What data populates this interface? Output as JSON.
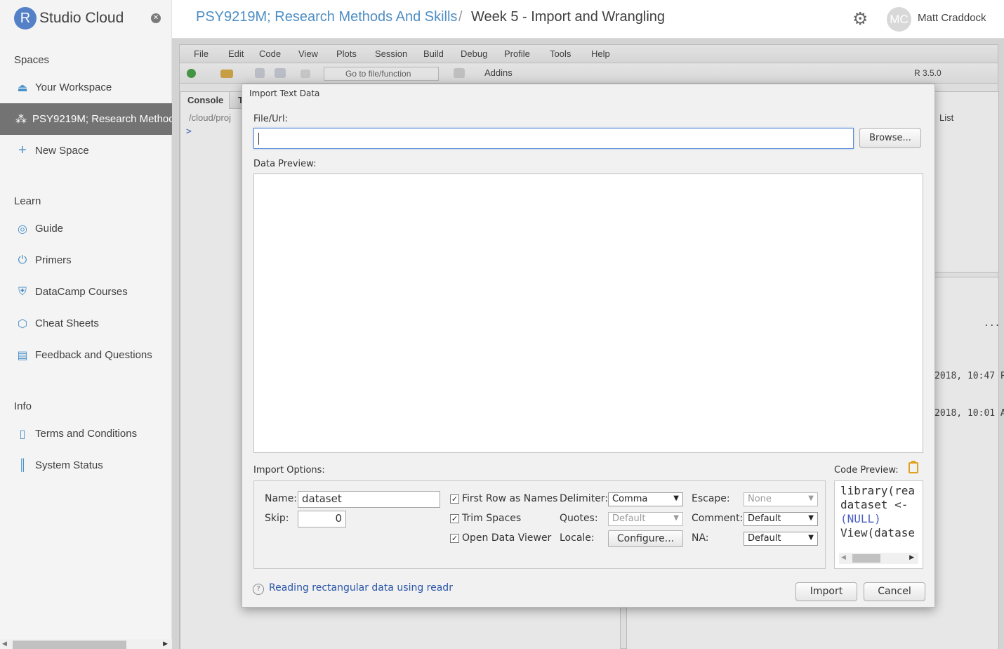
{
  "app": {
    "logo_letter": "R",
    "logo_text": "Studio Cloud"
  },
  "header": {
    "space_name": "PSY9219M; Research Methods And Skills",
    "separator": "/",
    "project_name": "Week 5 - Import and Wrangling",
    "avatar_initials": "MC",
    "user_name": "Matt Craddock"
  },
  "sidebar": {
    "spaces_heading": "Spaces",
    "your_workspace": "Your Workspace",
    "active_space": "PSY9219M; Research Methods And Skills",
    "new_space": "New Space",
    "learn_heading": "Learn",
    "guide": "Guide",
    "primers": "Primers",
    "datacamp": "DataCamp Courses",
    "cheat_sheets": "Cheat Sheets",
    "feedback": "Feedback and Questions",
    "info_heading": "Info",
    "terms": "Terms and Conditions",
    "system_status": "System Status"
  },
  "rstudio": {
    "menu": [
      "File",
      "Edit",
      "Code",
      "View",
      "Plots",
      "Session",
      "Build",
      "Debug",
      "Profile",
      "Tools",
      "Help"
    ],
    "goto_placeholder": "Go to file/function",
    "addins": "Addins",
    "r_version": "R 3.5.0",
    "console_tab": "Console",
    "console_tab_partial": "T",
    "console_path": "/cloud/proj",
    "prompt": ">",
    "env_list_label": "List",
    "files_date_1": "2018, 10:47 P",
    "files_date_2": "2018, 10:01 A",
    "more_dots": "..."
  },
  "dialog": {
    "title": "Import Text Data",
    "file_url_label": "File/Url:",
    "file_url_value": "",
    "browse_button": "Browse...",
    "data_preview_label": "Data Preview:",
    "import_options_label": "Import Options:",
    "code_preview_label": "Code Preview:",
    "name_label": "Name:",
    "name_value": "dataset",
    "skip_label": "Skip:",
    "skip_value": "0",
    "first_row_names": "First Row as Names",
    "trim_spaces": "Trim Spaces",
    "open_viewer": "Open Data Viewer",
    "delimiter_label": "Delimiter:",
    "delimiter_value": "Comma",
    "quotes_label": "Quotes:",
    "quotes_value": "Default",
    "locale_label": "Locale:",
    "configure_button": "Configure...",
    "escape_label": "Escape:",
    "escape_value": "None",
    "comment_label": "Comment:",
    "comment_value": "Default",
    "na_label": "NA:",
    "na_value": "Default",
    "code_line_1": "library(rea",
    "code_line_2": "dataset <-",
    "code_line_3": "(NULL)",
    "code_line_4": "View(datase",
    "help_icon_glyph": "?",
    "help_link": "Reading rectangular data using readr",
    "import_button": "Import",
    "cancel_button": "Cancel"
  },
  "colors": {
    "accent_blue": "#4e8ec4",
    "sidebar_active": "#737373",
    "link": "#2a55a8"
  }
}
